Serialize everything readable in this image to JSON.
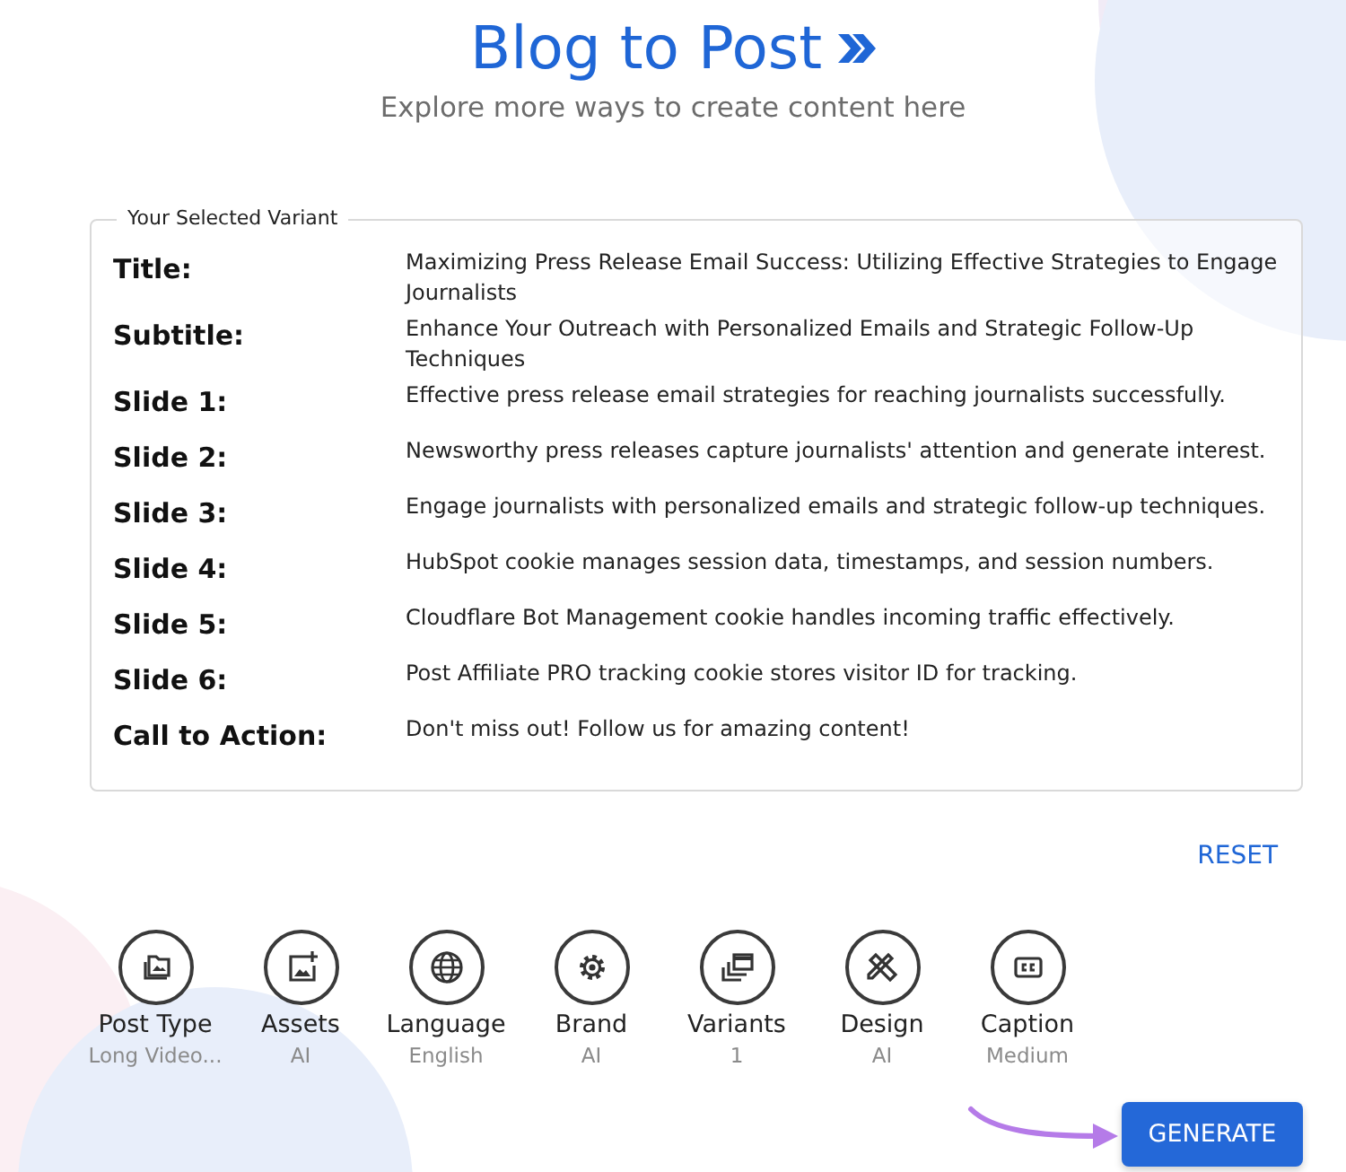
{
  "header": {
    "title": "Blog to Post",
    "subtitle": "Explore more ways to create content here"
  },
  "variant": {
    "legend": "Your Selected Variant",
    "fields": [
      {
        "label": "Title:",
        "value": "Maximizing Press Release Email Success: Utilizing Effective Strategies to Engage Journalists"
      },
      {
        "label": "Subtitle:",
        "value": "Enhance Your Outreach with Personalized Emails and Strategic Follow-Up Techniques"
      },
      {
        "label": "Slide 1:",
        "value": "Effective press release email strategies for reaching journalists successfully."
      },
      {
        "label": "Slide 2:",
        "value": "Newsworthy press releases capture journalists' attention and generate interest."
      },
      {
        "label": "Slide 3:",
        "value": "Engage journalists with personalized emails and strategic follow-up techniques."
      },
      {
        "label": "Slide 4:",
        "value": "HubSpot cookie manages session data, timestamps, and session numbers."
      },
      {
        "label": "Slide 5:",
        "value": "Cloudflare Bot Management cookie handles incoming traffic effectively."
      },
      {
        "label": "Slide 6:",
        "value": "Post Affiliate PRO tracking cookie stores visitor ID for tracking."
      },
      {
        "label": "Call to Action:",
        "value": "Don't miss out! Follow us for amazing content!"
      }
    ]
  },
  "reset_button": "RESET",
  "options": [
    {
      "kind": "folder",
      "label": "Post Type",
      "value": "Long Video..."
    },
    {
      "kind": "image",
      "label": "Assets",
      "value": "AI"
    },
    {
      "kind": "globe",
      "label": "Language",
      "value": "English"
    },
    {
      "kind": "gear",
      "label": "Brand",
      "value": "AI"
    },
    {
      "kind": "stack",
      "label": "Variants",
      "value": "1"
    },
    {
      "kind": "tools",
      "label": "Design",
      "value": "AI"
    },
    {
      "kind": "cc",
      "label": "Caption",
      "value": "Medium"
    }
  ],
  "generate_button": "GENERATE"
}
